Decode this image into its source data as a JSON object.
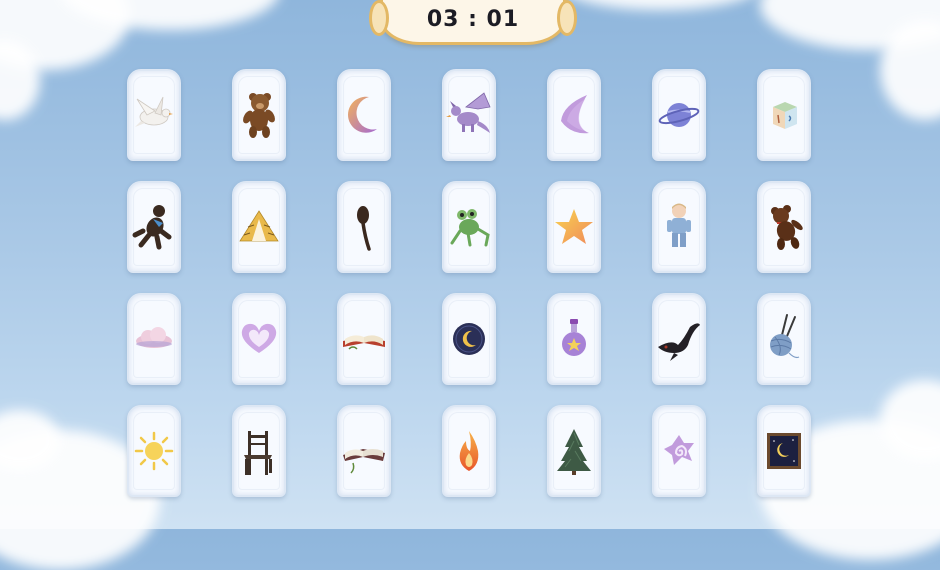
{
  "timer": {
    "display": "03 : 01"
  },
  "board": {
    "rows": [
      [
        "dove-icon",
        "teddy-bear-icon",
        "crescent-moon-icon",
        "dragon-icon",
        "purple-crescent-icon",
        "planet-icon",
        "toy-block-icon"
      ],
      [
        "doll-icon",
        "tent-icon",
        "spoon-icon",
        "frog-icon",
        "star-icon",
        "boy-in-pajamas-icon",
        "teddy-bear-icon"
      ],
      [
        "pink-cloud-icon",
        "purple-heart-icon",
        "open-book-icon",
        "moon-badge-icon",
        "potion-bottle-icon",
        "swallow-bird-icon",
        "yarn-ball-icon"
      ],
      [
        "sun-icon",
        "chair-icon",
        "book-icon",
        "flame-icon",
        "pine-tree-icon",
        "purple-spiral-icon",
        "night-window-icon"
      ]
    ]
  },
  "colors": {
    "sky": "#a9c8e6",
    "card": "#f7faff",
    "timer_border": "#e3b865"
  }
}
